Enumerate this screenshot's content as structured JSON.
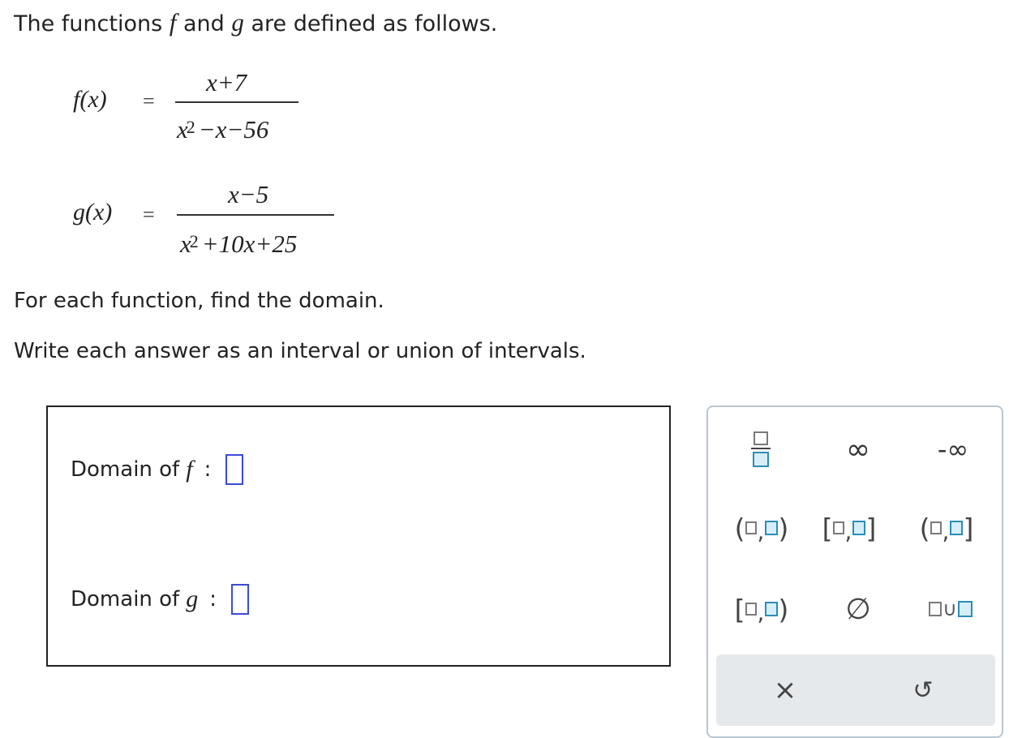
{
  "intro": {
    "before": "The functions",
    "f": "f",
    "and": "and",
    "g": "g",
    "after": "are defined as follows."
  },
  "f_def": {
    "name": "f",
    "arg": "(x)",
    "equals": "=",
    "numerator": "x+7",
    "denominator_lead": "x",
    "denominator_exp": "2",
    "denominator_rest": "−x−56"
  },
  "g_def": {
    "name": "g",
    "arg": "(x)",
    "equals": "=",
    "numerator": "x−5",
    "denominator_lead": "x",
    "denominator_exp": "2",
    "denominator_rest": "+10x+25"
  },
  "instructions": {
    "line1": "For each function, find the domain.",
    "line2": "Write each answer as an interval or union of intervals."
  },
  "answers": {
    "domain_prefix": "Domain of",
    "f_var": "f",
    "g_var": "g",
    "colon": ":",
    "f_value": "",
    "g_value": ""
  },
  "keypad": {
    "infinity": "∞",
    "neg_infinity": "-∞",
    "empty_set": "∅",
    "union": "∪",
    "clear": "×",
    "undo": "↺",
    "open_paren": "(",
    "close_paren": ")",
    "open_bracket": "[",
    "close_bracket": "]",
    "comma": ","
  },
  "colors": {
    "input_border": "#3a4bd8",
    "key_box_fill": "#d7eef8",
    "key_box_border": "#2b8db6",
    "footer_bg": "#e5e9ec"
  }
}
